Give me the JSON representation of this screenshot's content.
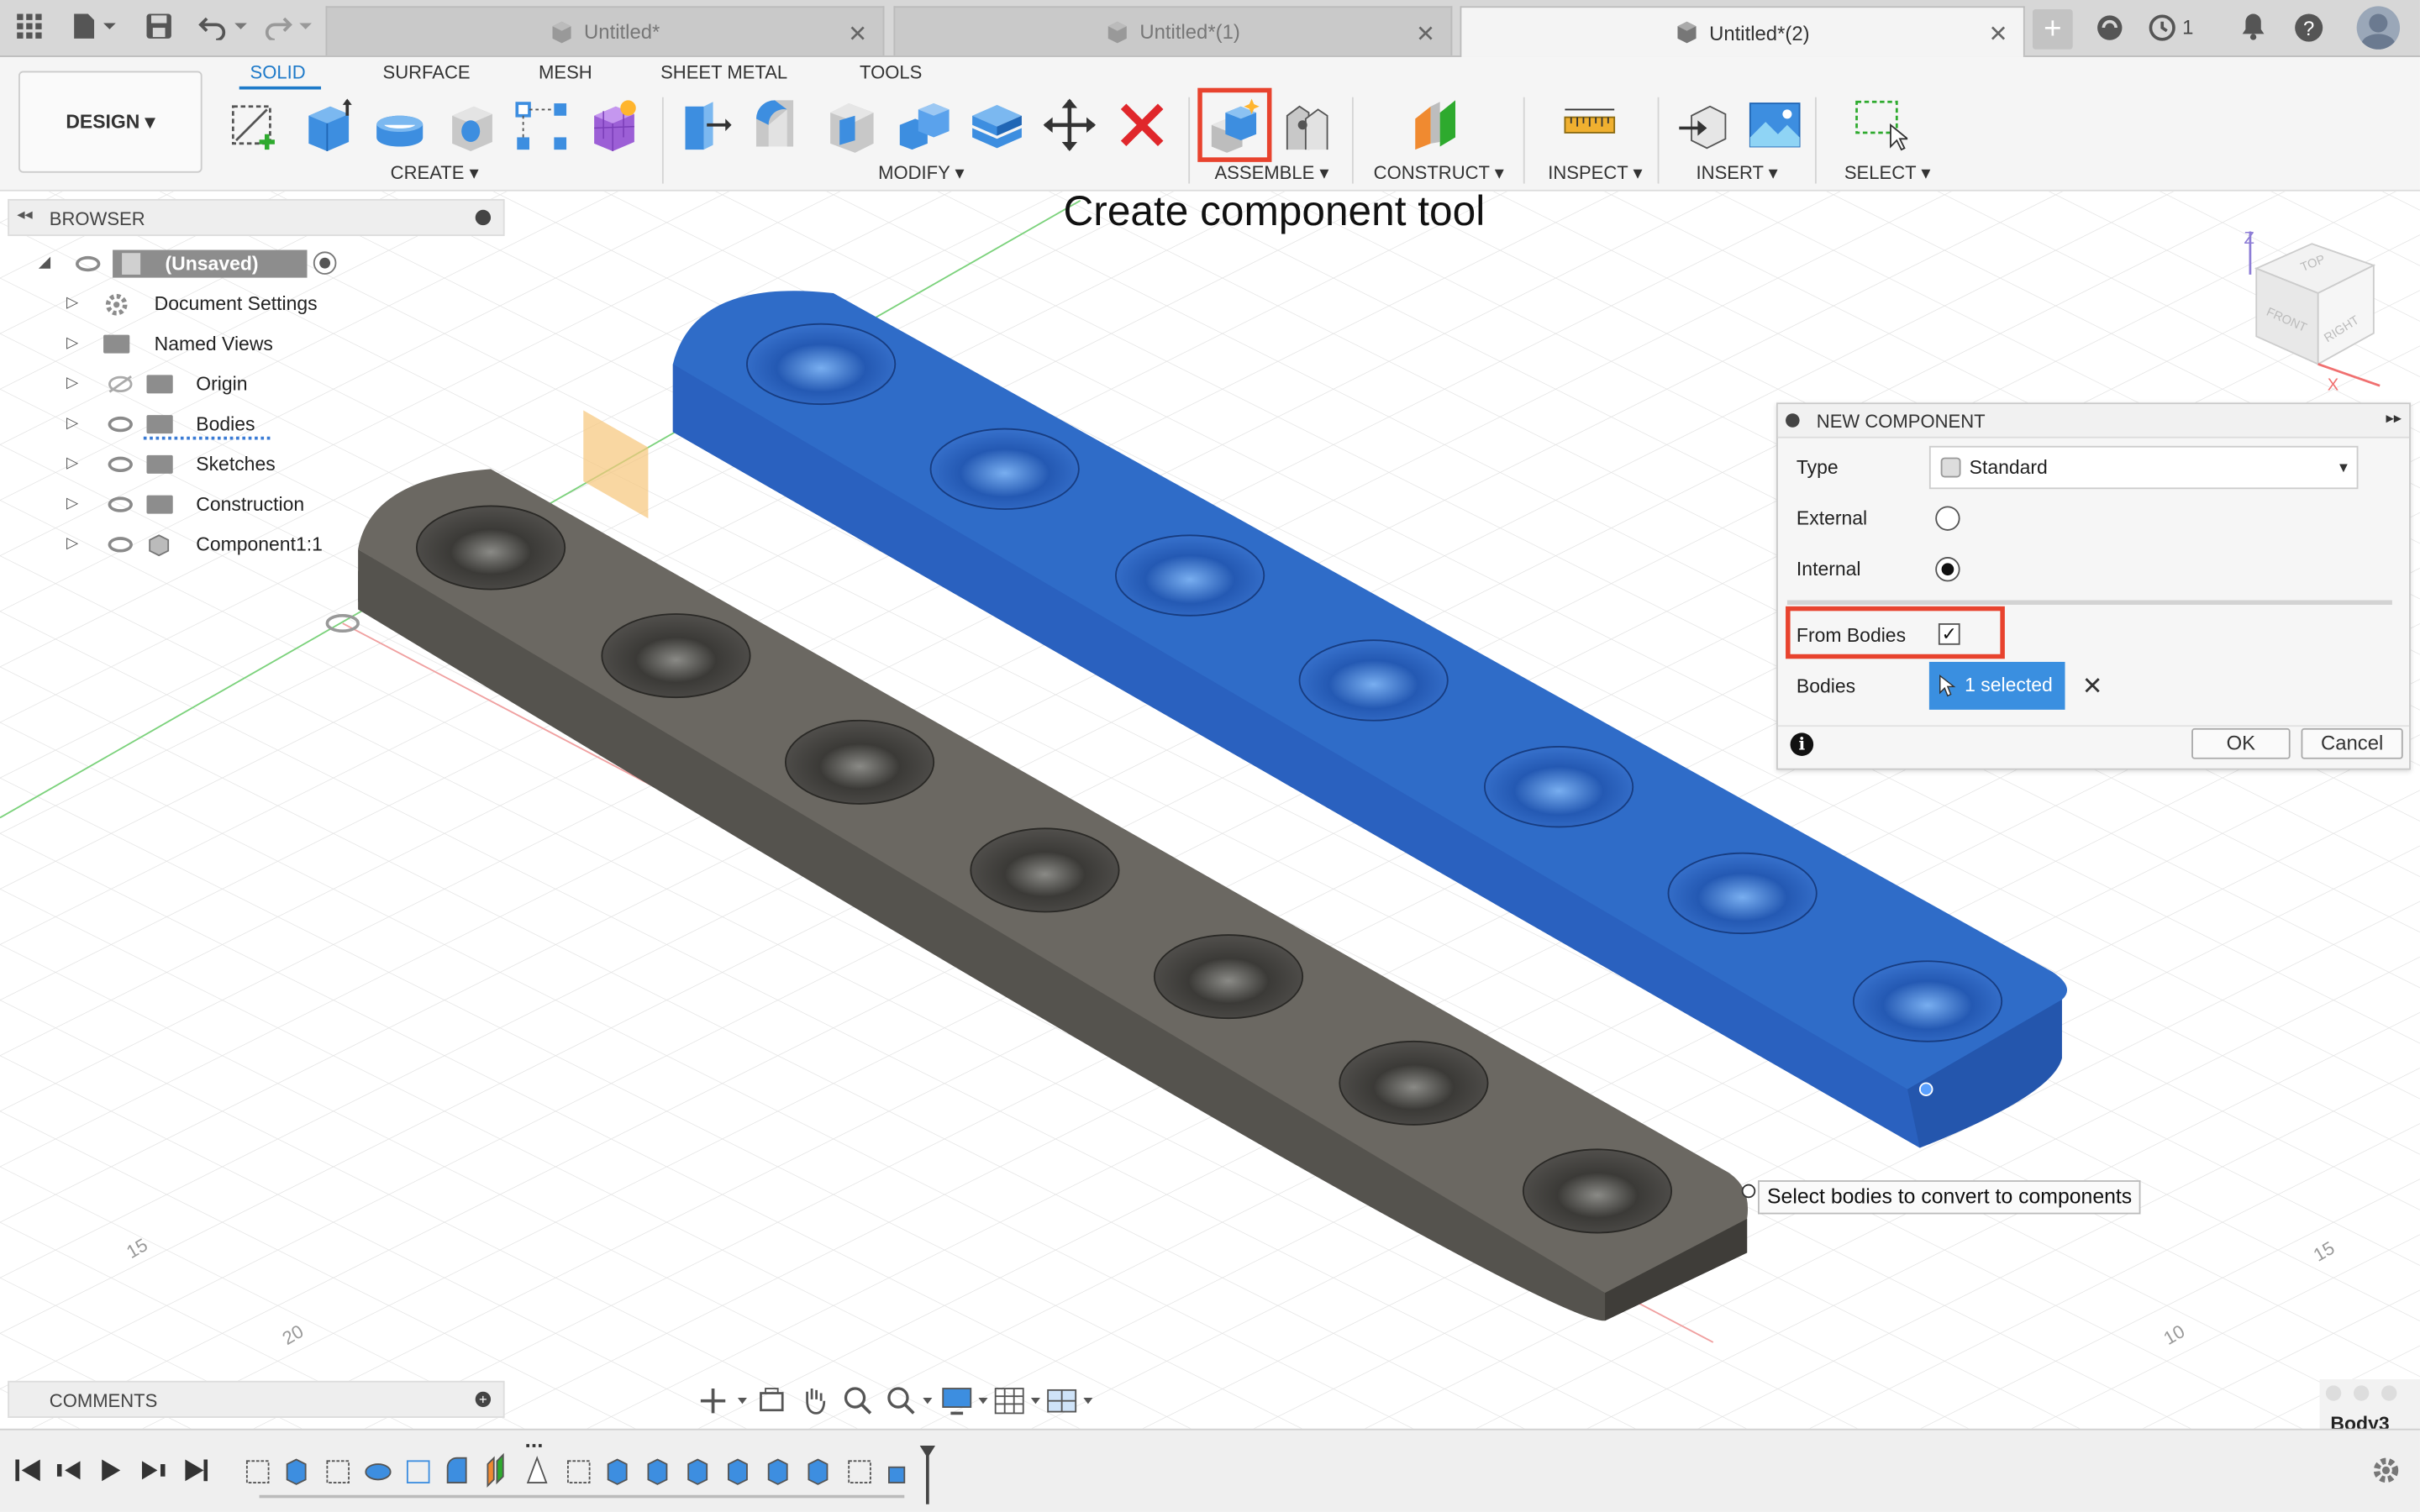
{
  "colors": {
    "accent": "#1e7ac9",
    "highlight": "#e8432e",
    "blue_body": "#2f6cc8",
    "grey_body": "#5e5b55"
  },
  "tabs": [
    {
      "label": "Untitled*",
      "active": false
    },
    {
      "label": "Untitled*(1)",
      "active": false
    },
    {
      "label": "Untitled*(2)",
      "active": true
    }
  ],
  "top_right": {
    "jobs_count": "1"
  },
  "toolbar": {
    "design_button": "DESIGN ▾",
    "workspace_tabs": [
      "SOLID",
      "SURFACE",
      "MESH",
      "SHEET METAL",
      "TOOLS"
    ],
    "groups": {
      "create": "CREATE ▾",
      "modify": "MODIFY ▾",
      "assemble": "ASSEMBLE ▾",
      "construct": "CONSTRUCT ▾",
      "inspect": "INSPECT ▾",
      "insert": "INSERT ▾",
      "select": "SELECT ▾"
    }
  },
  "annotation_title": "Create component tool",
  "browser": {
    "title": "BROWSER",
    "root": "(Unsaved)",
    "items": [
      {
        "label": "Document Settings",
        "icon": "gear-icon"
      },
      {
        "label": "Named Views",
        "icon": "folder-icon"
      },
      {
        "label": "Origin",
        "icon": "folder-icon"
      },
      {
        "label": "Bodies",
        "icon": "folder-icon"
      },
      {
        "label": "Sketches",
        "icon": "folder-icon"
      },
      {
        "label": "Construction",
        "icon": "folder-icon"
      },
      {
        "label": "Component1:1",
        "icon": "component-icon"
      }
    ]
  },
  "dialog": {
    "title": "NEW COMPONENT",
    "type_label": "Type",
    "type_value": "Standard",
    "external_label": "External",
    "internal_label": "Internal",
    "from_bodies_label": "From Bodies",
    "bodies_label": "Bodies",
    "bodies_value": "1 selected",
    "ok": "OK",
    "cancel": "Cancel"
  },
  "tooltip": "Select bodies to convert to components",
  "viewcube": {
    "top": "TOP",
    "front": "FRONT",
    "right": "RIGHT"
  },
  "grid_labels": {
    "l1": "15",
    "l2": "20",
    "r1": "15",
    "r2": "10"
  },
  "comments": {
    "title": "COMMENTS"
  },
  "status": {
    "body_name": "Body3"
  }
}
